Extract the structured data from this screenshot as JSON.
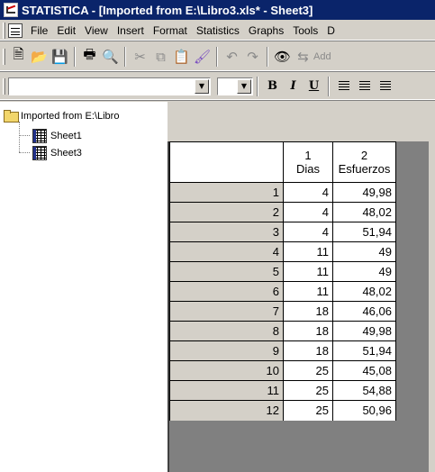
{
  "titlebar": {
    "title": "STATISTICA - [Imported from E:\\Libro3.xls* - Sheet3]"
  },
  "menubar": {
    "items": [
      "File",
      "Edit",
      "View",
      "Insert",
      "Format",
      "Statistics",
      "Graphs",
      "Tools",
      "D"
    ]
  },
  "toolbar": {
    "add_label": "Add"
  },
  "format_toolbar": {
    "font_name": "",
    "font_size": "",
    "bold": "B",
    "italic": "I",
    "underline": "U"
  },
  "tree": {
    "root": "Imported from E:\\Libro",
    "children": [
      "Sheet1",
      "Sheet3"
    ]
  },
  "spreadsheet": {
    "columns": [
      {
        "number": "1",
        "name": "Dias"
      },
      {
        "number": "2",
        "name": "Esfuerzos"
      }
    ],
    "rows": [
      {
        "row": "1",
        "dias": "4",
        "esfuerzos": "49,98"
      },
      {
        "row": "2",
        "dias": "4",
        "esfuerzos": "48,02"
      },
      {
        "row": "3",
        "dias": "4",
        "esfuerzos": "51,94"
      },
      {
        "row": "4",
        "dias": "11",
        "esfuerzos": "49"
      },
      {
        "row": "5",
        "dias": "11",
        "esfuerzos": "49"
      },
      {
        "row": "6",
        "dias": "11",
        "esfuerzos": "48,02"
      },
      {
        "row": "7",
        "dias": "18",
        "esfuerzos": "46,06"
      },
      {
        "row": "8",
        "dias": "18",
        "esfuerzos": "49,98"
      },
      {
        "row": "9",
        "dias": "18",
        "esfuerzos": "51,94"
      },
      {
        "row": "10",
        "dias": "25",
        "esfuerzos": "45,08"
      },
      {
        "row": "11",
        "dias": "25",
        "esfuerzos": "54,88"
      },
      {
        "row": "12",
        "dias": "25",
        "esfuerzos": "50,96"
      }
    ]
  }
}
